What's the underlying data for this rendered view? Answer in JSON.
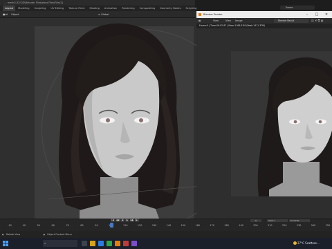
{
  "window": {
    "title": "... mesh3 [D:\\3D\\Blender Files\\ebra Files\\Files2]"
  },
  "workspace_tabs": [
    "Layout",
    "Modeling",
    "Sculpting",
    "UV Editing",
    "Texture Paint",
    "Shading",
    "Animation",
    "Rendering",
    "Compositing",
    "Geometry Nodes",
    "Scripting"
  ],
  "active_workspace": "Layout",
  "scene": {
    "label": "Scene"
  },
  "viewport_header": {
    "menus": [
      "Add",
      "Object"
    ],
    "orientation": "Global"
  },
  "render_window": {
    "title": "Blender Render",
    "menus": [
      "View",
      "View",
      "Image"
    ],
    "slot_label": "Blender Result",
    "status": "Frame:0 | Time:00:02.87 | Mem:1166.51M (Peak:1411.37M)"
  },
  "timeline": {
    "ticks": [
      "-10",
      "40",
      "50",
      "60",
      "70",
      "80",
      "90",
      "100",
      "110",
      "120",
      "130",
      "140",
      "150",
      "160",
      "170",
      "180",
      "190",
      "200",
      "210",
      "220",
      "230",
      "240",
      "250"
    ],
    "current_frame": "0",
    "start_label": "Start",
    "start_value": "1",
    "end_label": "End",
    "end_value": "250",
    "controls": [
      "|◀",
      "◀◀",
      "◀",
      "▶",
      "▶▶",
      "▶|"
    ],
    "playhead_position": 0.32
  },
  "statusbar": {
    "left": "Rotate View",
    "middle": "Object Context Menu"
  },
  "taskbar": {
    "search_placeholder": "",
    "weather": "27°C  Scattere..."
  },
  "colors": {
    "accent": "#4a78c2",
    "active_tab": "#3d3d3d",
    "taskbar": "#1a1f2a"
  }
}
